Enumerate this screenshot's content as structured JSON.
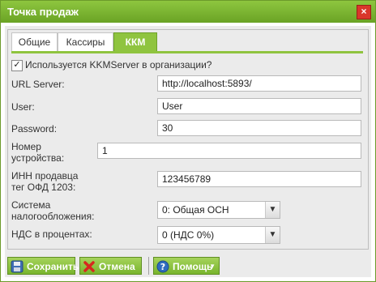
{
  "window": {
    "title": "Точка продаж",
    "close_icon": "close-icon",
    "accent_color": "#8fc43f"
  },
  "tabs": [
    {
      "label": "Общие",
      "active": false
    },
    {
      "label": "Кассиры",
      "active": false
    },
    {
      "label": "ККМ",
      "active": true
    }
  ],
  "form": {
    "use_kkm": {
      "label": "Используется KKMServer в организации?",
      "checked": true,
      "mark": "✓"
    },
    "url": {
      "label": "URL Server:",
      "value": "http://localhost:5893/"
    },
    "user": {
      "label": "User:",
      "value": "User"
    },
    "password": {
      "label": "Password:",
      "value": "30"
    },
    "device": {
      "label_line1": "Номер",
      "label_line2": "устройства:",
      "value": "1"
    },
    "inn": {
      "label_line1": "ИНН продавца",
      "label_line2": "тег ОФД 1203:",
      "value": "123456789"
    },
    "tax_system": {
      "label_line1": "Система",
      "label_line2": "налогообложения:",
      "value": "0: Общая ОСН"
    },
    "vat": {
      "label": "НДС в процентах:",
      "value": "0 (НДС 0%)"
    }
  },
  "buttons": {
    "save": {
      "label": "Сохранить",
      "icon": "save-icon"
    },
    "cancel": {
      "label": "Отмена",
      "icon": "cancel-icon"
    },
    "help": {
      "label": "Помощь",
      "icon": "help-icon"
    }
  }
}
